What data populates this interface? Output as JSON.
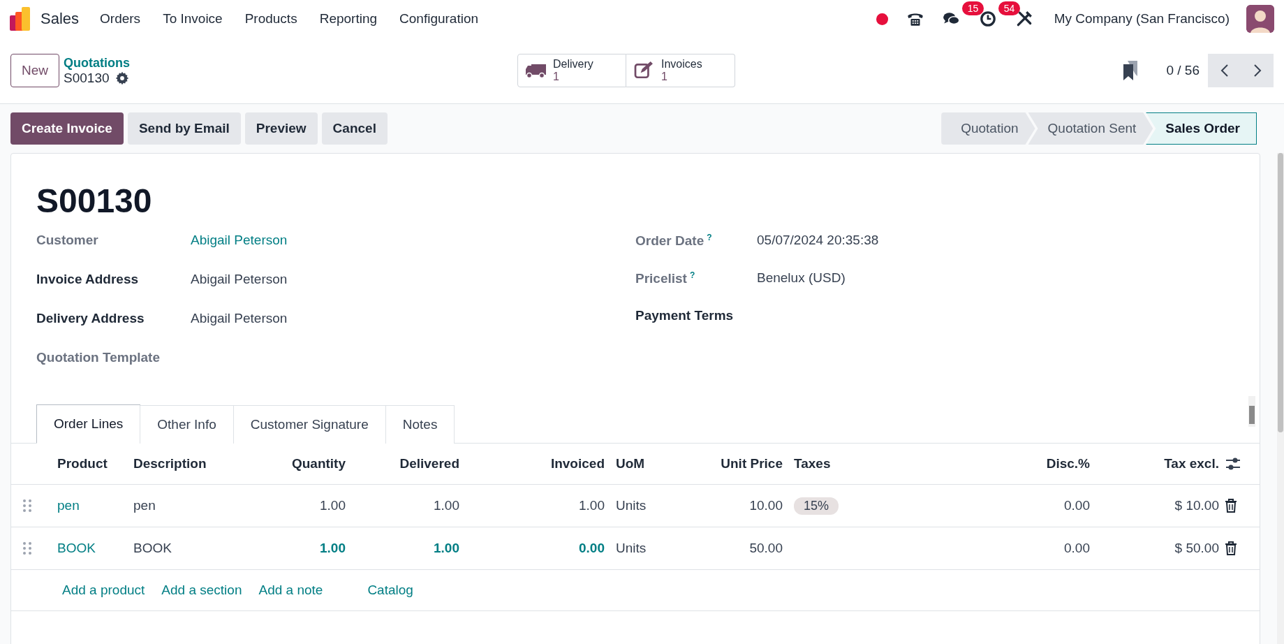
{
  "navbar": {
    "app": "Sales",
    "menu": [
      "Orders",
      "To Invoice",
      "Products",
      "Reporting",
      "Configuration"
    ],
    "systray": [
      {
        "kind": "dot"
      },
      {
        "kind": "phone"
      },
      {
        "kind": "chat",
        "badge": "15"
      },
      {
        "kind": "clock",
        "badge": "54"
      },
      {
        "kind": "tools"
      }
    ],
    "company": "My Company (San Francisco)"
  },
  "control": {
    "new_button": "New",
    "breadcrumb": "Quotations",
    "record": "S00130",
    "smart_buttons": [
      {
        "kind": "truck",
        "label": "Delivery",
        "value": "1"
      },
      {
        "kind": "edit",
        "label": "Invoices",
        "value": "1"
      }
    ],
    "pager": "0 / 56"
  },
  "actions": [
    {
      "label": "Create Invoice",
      "primary": true
    },
    {
      "label": "Send by Email",
      "primary": false
    },
    {
      "label": "Preview",
      "primary": false
    },
    {
      "label": "Cancel",
      "primary": false
    }
  ],
  "statusbar": [
    {
      "label": "Quotation",
      "selected": false
    },
    {
      "label": "Quotation Sent",
      "selected": false
    },
    {
      "label": "Sales Order",
      "selected": true
    }
  ],
  "form": {
    "title": "S00130",
    "left_fields": [
      {
        "label": "Customer",
        "value": "Abigail Peterson",
        "bold": false,
        "link": true
      },
      {
        "label": "Invoice Address",
        "value": "Abigail Peterson",
        "bold": true,
        "link": false
      },
      {
        "label": "Delivery Address",
        "value": "Abigail Peterson",
        "bold": true,
        "link": false
      },
      {
        "label": "Quotation Template",
        "bold": false
      }
    ],
    "right_fields": [
      {
        "label": "Order Date",
        "help": "?",
        "value": "05/07/2024 20:35:38",
        "bold": false
      },
      {
        "label": "Pricelist",
        "help": "?",
        "value": "Benelux (USD)",
        "bold": false
      },
      {
        "label": "Payment Terms",
        "bold": true
      }
    ]
  },
  "tabs": [
    {
      "label": "Order Lines",
      "selected": true
    },
    {
      "label": "Other Info",
      "selected": false
    },
    {
      "label": "Customer Signature",
      "selected": false
    },
    {
      "label": "Notes",
      "selected": false
    }
  ],
  "table": {
    "columns": [
      {
        "label": "Product",
        "numeric": false
      },
      {
        "label": "Description",
        "numeric": false
      },
      {
        "label": "Quantity",
        "numeric": true
      },
      {
        "label": "Delivered",
        "numeric": true
      },
      {
        "label": "Invoiced",
        "numeric": true
      },
      {
        "label": "UoM",
        "numeric": false
      },
      {
        "label": "Unit Price",
        "numeric": true
      },
      {
        "label": "Taxes",
        "numeric": false
      },
      {
        "label": "Disc.%",
        "numeric": true
      },
      {
        "label": "Tax excl.",
        "numeric": true
      }
    ],
    "rows": [
      {
        "product": "pen",
        "description": "pen",
        "quantity": "1.00",
        "delivered": "1.00",
        "invoiced": "1.00",
        "uom": "Units",
        "unit_price": "10.00",
        "taxes": [
          "15%"
        ],
        "discount": "0.00",
        "subtotal": "$ 10.00",
        "highlight": false
      },
      {
        "product": "BOOK",
        "description": "BOOK",
        "quantity": "1.00",
        "delivered": "1.00",
        "invoiced": "0.00",
        "uom": "Units",
        "unit_price": "50.00",
        "taxes": [],
        "discount": "0.00",
        "subtotal": "$ 50.00",
        "highlight": true
      }
    ],
    "add_links": [
      "Add a product",
      "Add a section",
      "Add a note",
      "Catalog"
    ]
  }
}
